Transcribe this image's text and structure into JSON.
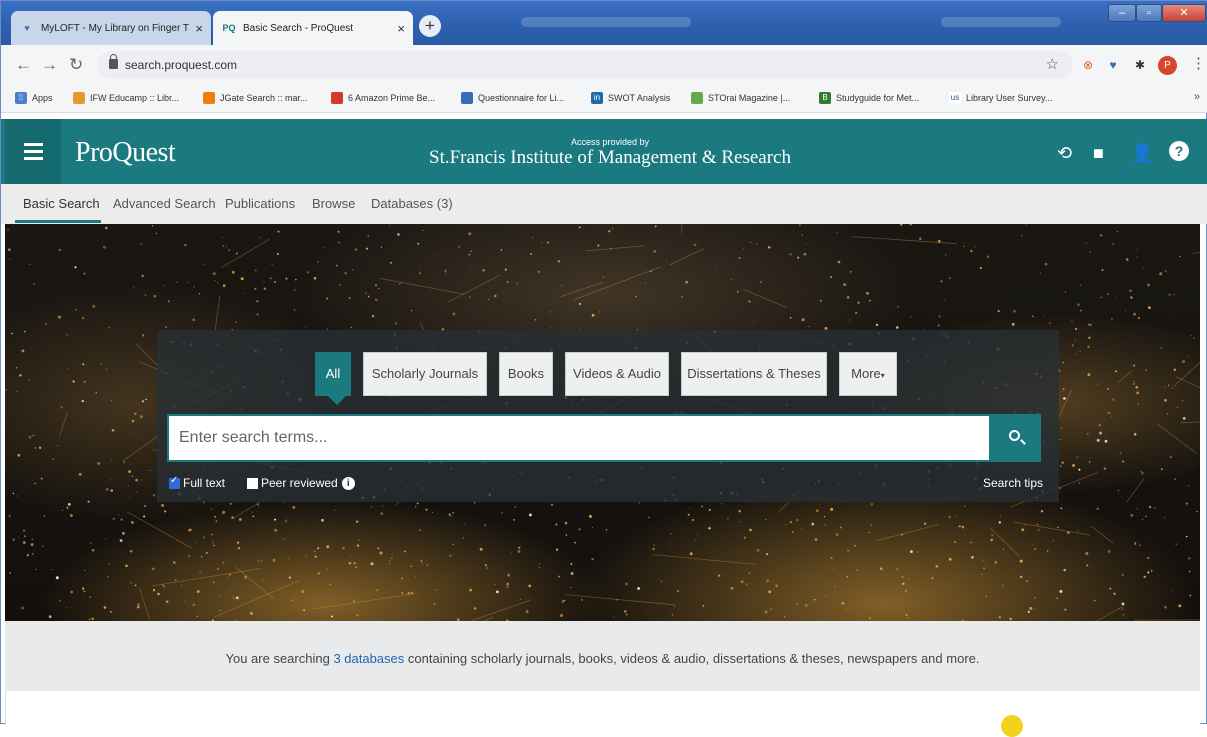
{
  "browser": {
    "tabs": [
      {
        "title": "MyLOFT - My Library on Finger T",
        "favicon": "myloft-heart-icon",
        "active": false
      },
      {
        "title": "Basic Search - ProQuest",
        "favicon": "PQ",
        "active": true
      }
    ],
    "url": "search.proquest.com",
    "avatar_letter": "P",
    "bookmarks": [
      {
        "label": "Apps",
        "icon": "apps-grid-icon"
      },
      {
        "label": "IFW Educamp :: Libr...",
        "icon": "educamp-icon"
      },
      {
        "label": "JGate Search :: mar...",
        "icon": "jgate-icon"
      },
      {
        "label": "6 Amazon Prime Be...",
        "icon": "amazon-icon"
      },
      {
        "label": "Questionnaire for Li...",
        "icon": "questionnaire-icon"
      },
      {
        "label": "SWOT Analysis",
        "icon": "linkedin-icon"
      },
      {
        "label": "STOrai Magazine |...",
        "icon": "storai-icon"
      },
      {
        "label": "Studyguide for Met...",
        "icon": "studyguide-icon"
      },
      {
        "label": "Library User Survey...",
        "icon": "survey-icon"
      }
    ],
    "bookmarks_more": "»"
  },
  "header": {
    "logo": "ProQuest",
    "access_label": "Access provided by",
    "institution": "St.Francis Institute of Management & Research",
    "icons": [
      "history-icon",
      "folder-icon",
      "user-icon",
      "help-icon"
    ]
  },
  "subnav": {
    "items": [
      "Basic Search",
      "Advanced Search",
      "Publications",
      "Browse",
      "Databases (3)"
    ]
  },
  "search": {
    "chips": [
      "All",
      "Scholarly Journals",
      "Books",
      "Videos & Audio",
      "Dissertations & Theses",
      "More"
    ],
    "placeholder": "Enter search terms...",
    "full_text": {
      "label": "Full text",
      "checked": true
    },
    "peer_reviewed": {
      "label": "Peer reviewed",
      "checked": false
    },
    "tips": "Search tips"
  },
  "info": {
    "prefix": "You are searching ",
    "link": "3 databases",
    "suffix": " containing scholarly journals, books, videos & audio, dissertations & theses, newspapers and more."
  },
  "colors": {
    "brand_teal": "#1a7a80",
    "link_blue": "#1f66b3",
    "browser_blue": "#2c5fae"
  }
}
